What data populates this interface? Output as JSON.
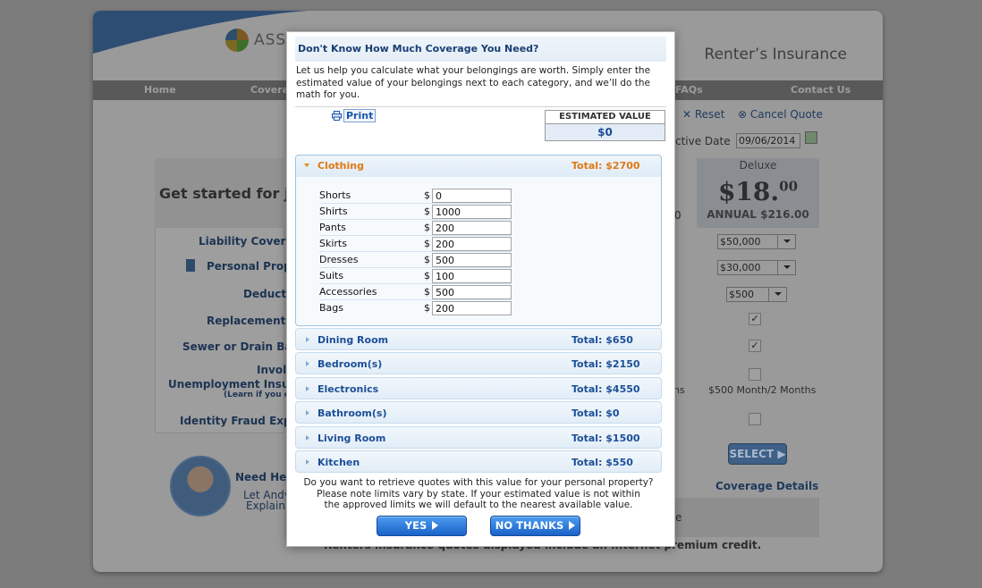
{
  "background": {
    "logo_text": "ASS",
    "brand_title": "Renter’s Insurance",
    "nav": [
      "Home",
      "Covera",
      "FAQs",
      "Contact Us"
    ],
    "reset": "Reset",
    "cancel_quote": "Cancel Quote",
    "effective_date_label": "ctive Date",
    "effective_date": "09/06/2014",
    "get_started": "Get started for ju",
    "rows": [
      "Liability Covera",
      "Personal Proper",
      "Deductil",
      "Replacement C",
      "Sewer or Drain Back",
      "Involu",
      "Unemployment Insuran",
      "(Learn if you c",
      "Identity Fraud Exper"
    ],
    "deluxe_label": "Deluxe",
    "price_main": "$18.",
    "price_cents": "00",
    "annual": "ANNUAL $216.00",
    "mid_zero": "0",
    "mid_ns": "ns",
    "liability_value": "$50,000",
    "personal_value": "$30,000",
    "deductible_value": "$500",
    "unemployment_value": "$500 Month/2 Months",
    "select_button": "SELECT",
    "coverage_details": "Coverage Details",
    "need_help": "Need Help",
    "let_andy": "Let Andy",
    "explain": "Explain",
    "bottom_e": "e",
    "footer_text": "Renters insurance quotes displayed include an Internet premium credit."
  },
  "modal": {
    "title": "Don't Know How Much Coverage You Need?",
    "intro": "Let us help you calculate what your belongings are worth. Simply enter the estimated value of your belongings next to each category, and we’ll do the math for you.",
    "print_label": "Print",
    "estimated_value_label": "ESTIMATED VALUE",
    "estimated_value": "$0",
    "open_category": {
      "name": "Clothing",
      "total": "Total: $2700",
      "items": [
        {
          "label": "Shorts",
          "currency": "$",
          "value": "0"
        },
        {
          "label": "Shirts",
          "currency": "$",
          "value": "1000"
        },
        {
          "label": "Pants",
          "currency": "$",
          "value": "200"
        },
        {
          "label": "Skirts",
          "currency": "$",
          "value": "200"
        },
        {
          "label": "Dresses",
          "currency": "$",
          "value": "500"
        },
        {
          "label": "Suits",
          "currency": "$",
          "value": "100"
        },
        {
          "label": "Accessories",
          "currency": "$",
          "value": "500"
        },
        {
          "label": "Bags",
          "currency": "$",
          "value": "200"
        }
      ]
    },
    "categories": [
      {
        "name": "Dining Room",
        "total": "Total: $650"
      },
      {
        "name": "Bedroom(s)",
        "total": "Total: $2150"
      },
      {
        "name": "Electronics",
        "total": "Total: $4550"
      },
      {
        "name": "Bathroom(s)",
        "total": "Total: $0"
      },
      {
        "name": "Living Room",
        "total": "Total: $1500"
      },
      {
        "name": "Kitchen",
        "total": "Total: $550"
      }
    ],
    "question_line1": "Do you want to retrieve quotes with this value for your personal property?",
    "question_line2": "Please note limits vary by state. If your estimated value is not within",
    "question_line3": "the approved limits we will default to the nearest available value.",
    "yes_label": "YES",
    "no_label": "NO THANKS"
  }
}
